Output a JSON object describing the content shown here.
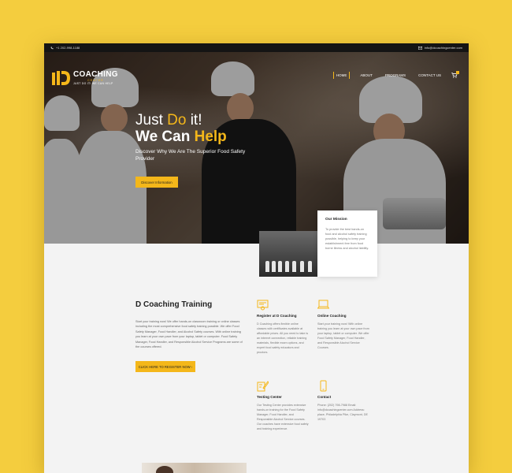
{
  "topbar": {
    "phone": "+1 202-998-1188",
    "email": "info@dcoachingcenter.com"
  },
  "logo": {
    "name": "COACHING",
    "sub": "CENTER",
    "tagline": "JUST DO IT! WE CAN HELP"
  },
  "nav": {
    "items": [
      "HOME",
      "ABOUT",
      "PROGRAMS",
      "CONTACT US"
    ],
    "active": "HOME"
  },
  "hero": {
    "line1_a": "Just ",
    "line1_b": "Do",
    "line1_c": " it!",
    "line2_a": "We Can ",
    "line2_b": "Help",
    "subtitle": "Discover Why We Are The Superior Food Safety Provider",
    "button": "Discover Information"
  },
  "mission": {
    "title": "Our Mission",
    "body": "To provide the best hands-on food and alcohol safety training possible, helping to keep your establishment free from food borne illness and alcohol liability."
  },
  "training": {
    "title": "D Coaching Training",
    "body": "Start your training now! We offer hands-on classroom training or online classes including the most comprehensive food safety training possible. We offer Food Safety Manager, Food Handler, and Alcohol Safety courses. With online training you learn at your own pace from your laptop, tablet or computer. Food Safety Manager, Food Handler, and Responsible Alcohol Service Programs are some of the courses offered.",
    "button": "CLICK HERE TO REGISTER NOW  ›"
  },
  "features": [
    {
      "title": "Register at D Coaching",
      "body": "D Coaching offers flexible online classes with certificates available at affordable prices. All you need to take is an internet connection, reliable training materials, flexible exam options, and expert food safety educators and proctors.",
      "icon": "certificate-icon"
    },
    {
      "title": "Online Coaching",
      "body": "Start your training now! With online training you learn at your own pace from your laptop, tablet or computer. We offer Food Safety Manager, Food Handler, and Responsible Alcohol Service Courses.",
      "icon": "laptop-icon"
    },
    {
      "title": "Testing Center",
      "body": "Our Testing Center provides extensive hands-on training for the Food Safety Manager, Food Handler, and Responsible Alcohol Service courses. Our coaches have extensive food safety and training experience.",
      "icon": "pencil-test-icon"
    },
    {
      "title": "Contact",
      "body": "Phone: (202) 798-7988 Email: info@dcoachingcenter.com Address: place, Philadelphia Pike, Claymont, DE 19703",
      "icon": "phone-icon"
    }
  ],
  "colors": {
    "accent": "#f4b71a",
    "background": "#f4cd3e",
    "topbar": "#141414"
  }
}
